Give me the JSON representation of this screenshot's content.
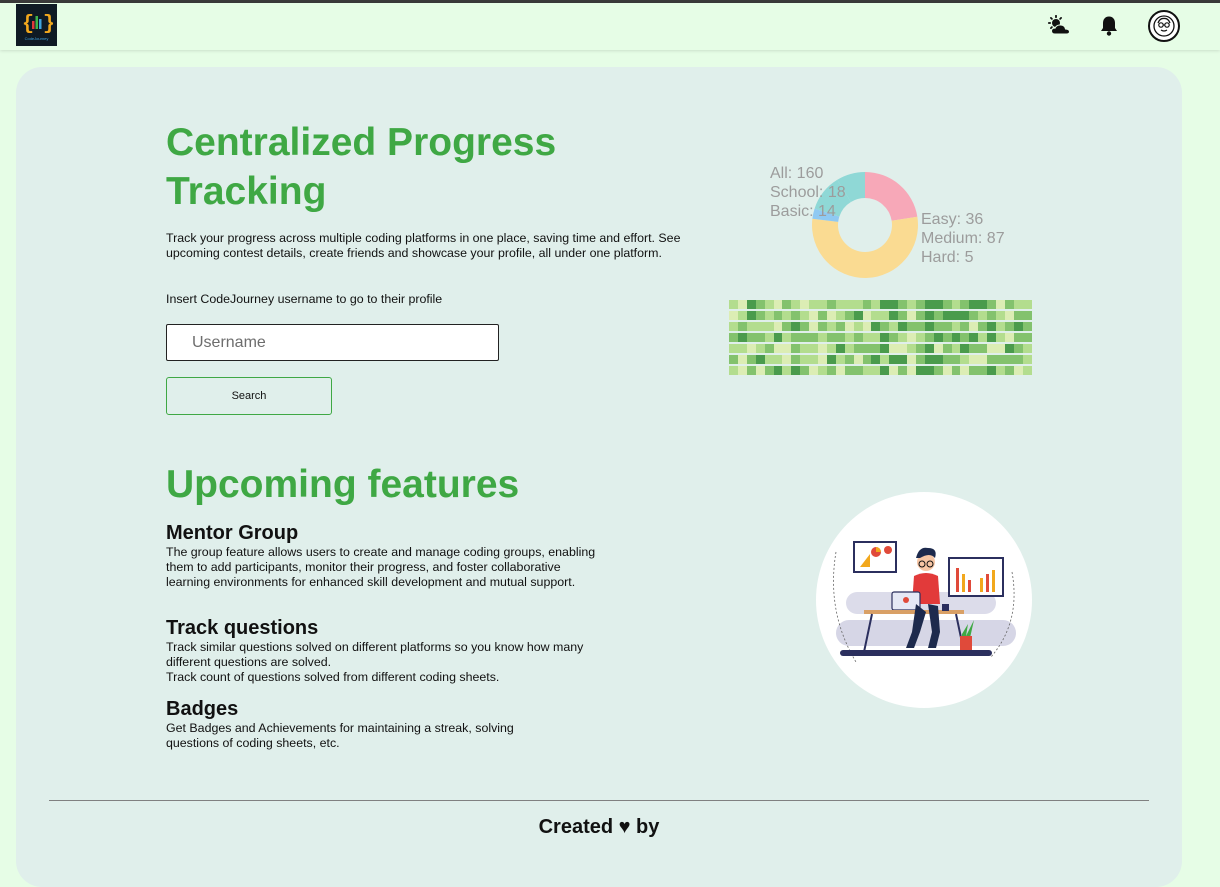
{
  "brand": {
    "logo_text": "CodeJourney"
  },
  "nav": {
    "icons": [
      "theme-toggle-icon",
      "bell-icon",
      "avatar-icon"
    ]
  },
  "hero": {
    "title": "Centralized Progress Tracking",
    "description": "Track your progress across multiple coding platforms in one place, saving time and effort. See upcoming contest details, create friends and showcase your profile, all under one platform.",
    "insert_label": "Insert CodeJourney username to go to their profile",
    "username_placeholder": "Username",
    "search_label": "Search"
  },
  "stats": {
    "left": [
      "All: 160",
      "School: 18",
      "Basic: 14"
    ],
    "right": [
      "Easy: 36",
      "Medium: 87",
      "Hard: 5"
    ]
  },
  "donut_segments": [
    {
      "name": "Easy",
      "value": 36,
      "color": "#f7a8b8"
    },
    {
      "name": "Medium",
      "value": 87,
      "color": "#fadb92"
    },
    {
      "name": "Hard",
      "value": 5,
      "color": "#8fc9f2"
    },
    {
      "name": "School",
      "value": 18,
      "color": "#8fd8d6"
    },
    {
      "name": "Basic",
      "value": 14,
      "color": "#8fd8d6"
    }
  ],
  "heatmap": {
    "colors": [
      "#dcedb4",
      "#b3dd8e",
      "#83c26d",
      "#4a9b4c"
    ],
    "rows": [
      "1032102101121112133212332123320211",
      "0132121210201230113202323332121022",
      "1211102320212010321322322120231232",
      "2322131222122121132101232323131022",
      "1101200211013122230012302132200321",
      "2023110211031202313302332210022221",
      "1020231320120221130203320202231201"
    ]
  },
  "features": {
    "title": "Upcoming features",
    "items": [
      {
        "title": "Mentor Group",
        "lines": [
          "The group feature allows users to create and manage coding groups, enabling them to add participants, monitor their progress, and foster collaborative learning environments for enhanced skill development and mutual support."
        ]
      },
      {
        "title": "Track questions",
        "lines": [
          "Track similar questions solved on different platforms so you know how many different questions are solved.",
          "Track count of questions solved from different coding sheets."
        ]
      },
      {
        "title": "Badges",
        "lines": [
          "Get Badges and Achievements for maintaining a streak, solving questions of coding sheets, etc."
        ]
      }
    ]
  },
  "footer": {
    "text": "Created ♥ by"
  }
}
